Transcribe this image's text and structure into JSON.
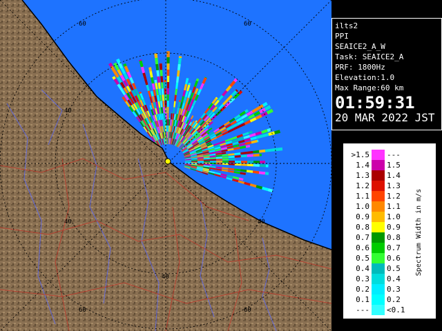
{
  "info": {
    "site": "ilts2",
    "product": "PPI",
    "scan": "SEAICE2_A_W",
    "task": "Task: SEAICE2_A",
    "prf": "PRF: 1800Hz",
    "elevation": "Elevation:1.0",
    "max_range": "Max Range:60 km",
    "time": "01:59:31",
    "date": "20 MAR 2022 JST"
  },
  "map": {
    "range_labels": [
      "60",
      "40",
      "40",
      "40",
      "40",
      "60",
      "60",
      "60"
    ],
    "colors": {
      "sea": "#1e73ff",
      "land": "#8a7052",
      "coast": "#000000",
      "rings": "#000000"
    }
  },
  "legend": {
    "title": "Spectrum Width in m/s",
    "rows": [
      {
        "left": ">1.5",
        "right": "---",
        "color": "#ff33ff"
      },
      {
        "left": "1.4",
        "right": "1.5",
        "color": "#cc00aa"
      },
      {
        "left": "1.3",
        "right": "1.4",
        "color": "#aa0000"
      },
      {
        "left": "1.2",
        "right": "1.3",
        "color": "#dd1100"
      },
      {
        "left": "1.1",
        "right": "1.2",
        "color": "#ff4400"
      },
      {
        "left": "1.0",
        "right": "1.1",
        "color": "#ff8800"
      },
      {
        "left": "0.9",
        "right": "1.0",
        "color": "#ffbb00"
      },
      {
        "left": "0.8",
        "right": "0.9",
        "color": "#ffff00"
      },
      {
        "left": "0.7",
        "right": "0.8",
        "color": "#009900"
      },
      {
        "left": "0.6",
        "right": "0.7",
        "color": "#00cc00"
      },
      {
        "left": "0.5",
        "right": "0.6",
        "color": "#33ff33"
      },
      {
        "left": "0.4",
        "right": "0.5",
        "color": "#00bbbb"
      },
      {
        "left": "0.3",
        "right": "0.4",
        "color": "#00dddd"
      },
      {
        "left": "0.2",
        "right": "0.3",
        "color": "#00eeff"
      },
      {
        "left": "0.1",
        "right": "0.2",
        "color": "#00ffff"
      },
      {
        "left": "---",
        "right": "<0.1",
        "color": "#33ffff"
      }
    ]
  }
}
